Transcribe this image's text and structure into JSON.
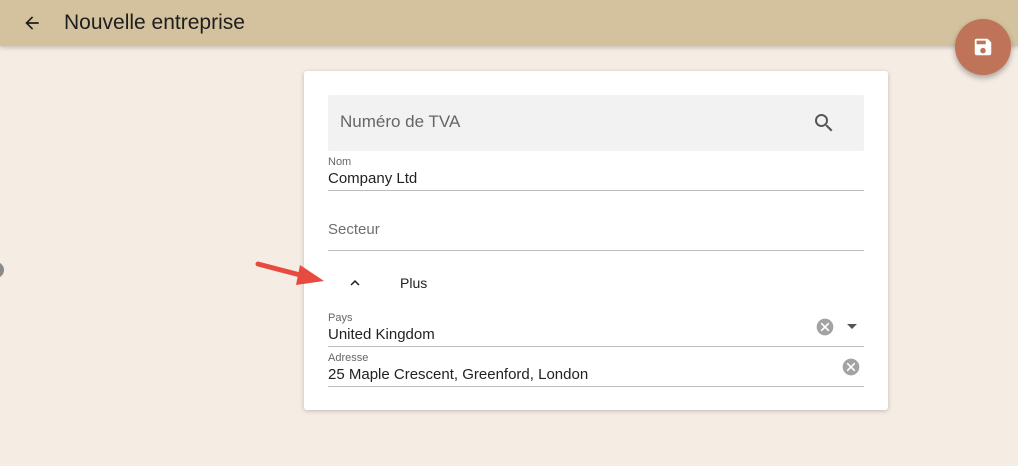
{
  "header": {
    "title": "Nouvelle entreprise",
    "back_icon": "arrow-left-icon",
    "save_icon": "save-icon",
    "color": "#d3c29d",
    "fab_color": "#bf7359"
  },
  "form": {
    "vat_search": {
      "placeholder": "Numéro de TVA",
      "icon": "search-icon"
    },
    "name": {
      "label": "Nom",
      "value": "Company Ltd"
    },
    "sector": {
      "placeholder": "Secteur"
    },
    "more_toggle": {
      "label": "Plus",
      "icon": "chevron-up-icon"
    },
    "country": {
      "label": "Pays",
      "value": "United Kingdom"
    },
    "address": {
      "label": "Adresse",
      "value": "25 Maple Crescent, Greenford, London"
    }
  },
  "annotation": {
    "color": "#e84a3f"
  }
}
